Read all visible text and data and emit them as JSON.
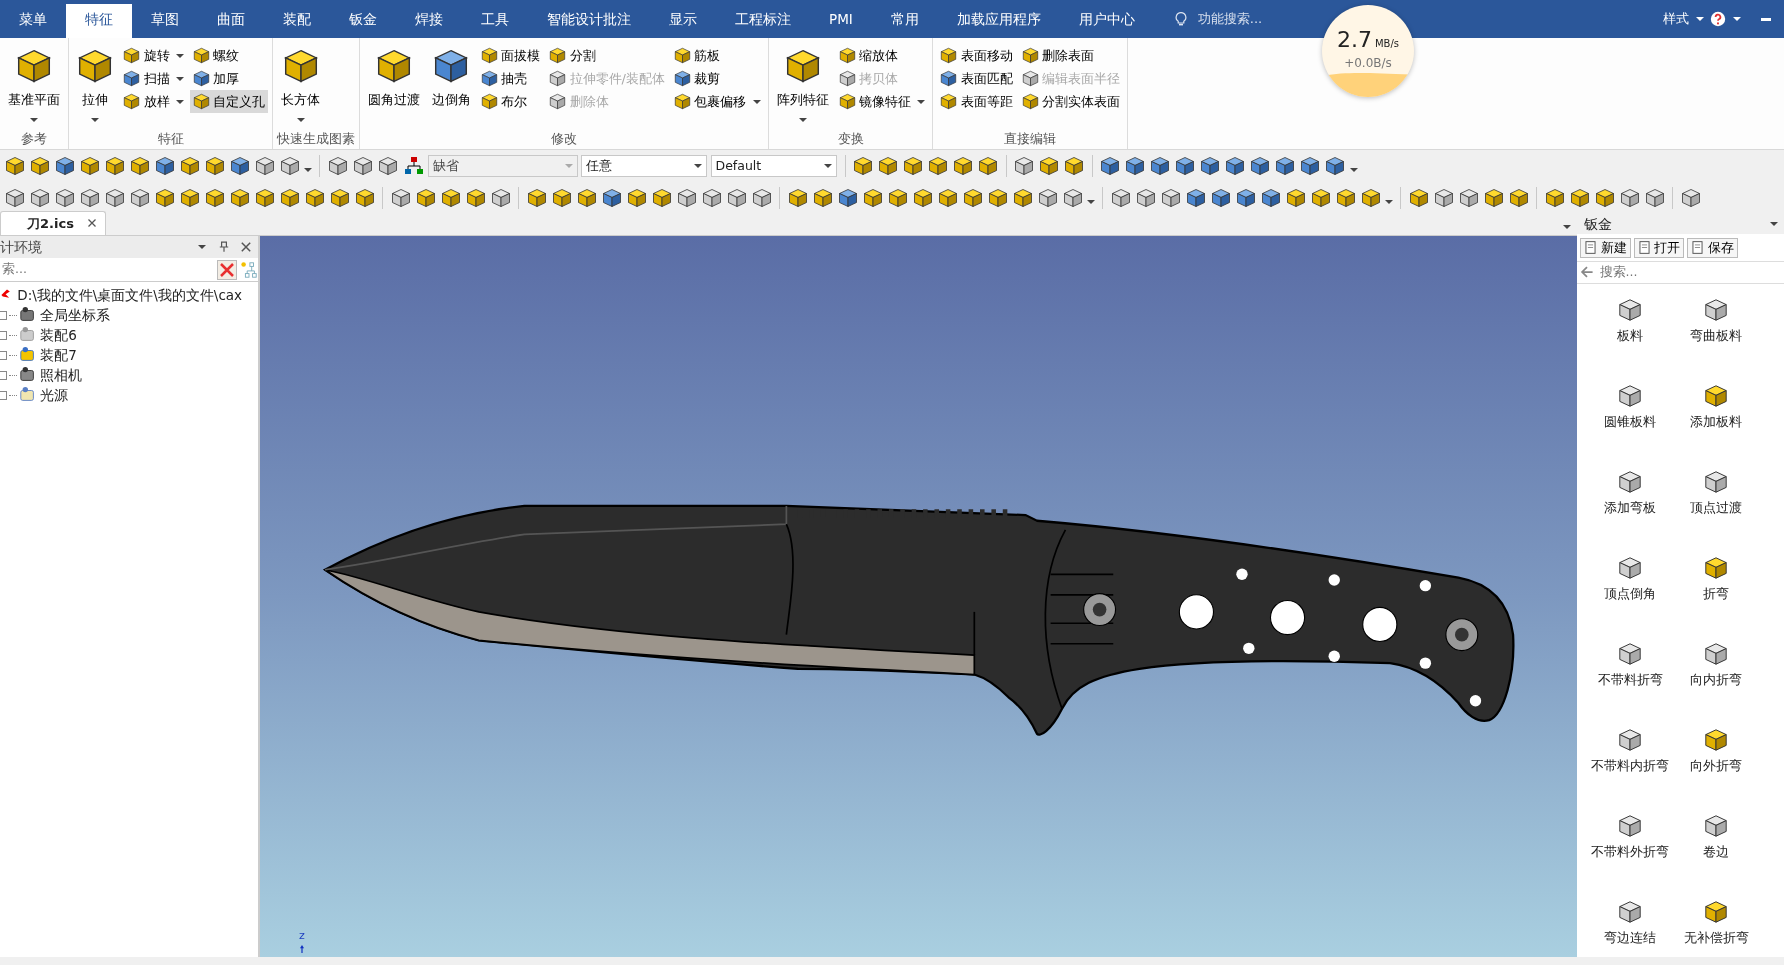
{
  "menu_tabs": [
    {
      "label": "菜单",
      "selected": false
    },
    {
      "label": "特征",
      "selected": true
    },
    {
      "label": "草图",
      "selected": false
    },
    {
      "label": "曲面",
      "selected": false
    },
    {
      "label": "装配",
      "selected": false
    },
    {
      "label": "钣金",
      "selected": false
    },
    {
      "label": "焊接",
      "selected": false
    },
    {
      "label": "工具",
      "selected": false
    },
    {
      "label": "智能设计批注",
      "selected": false
    },
    {
      "label": "显示",
      "selected": false
    },
    {
      "label": "工程标注",
      "selected": false
    },
    {
      "label": "PMI",
      "selected": false
    },
    {
      "label": "常用",
      "selected": false
    },
    {
      "label": "加载应用程序",
      "selected": false
    },
    {
      "label": "用户中心",
      "selected": false
    }
  ],
  "search": {
    "placeholder": "功能搜索..."
  },
  "style_menu": "样式",
  "speed_meter": {
    "value": "2.7",
    "unit": "MB/s",
    "delta": "+0.0B/s"
  },
  "ribbon_groups": [
    {
      "label": "参考",
      "columns": [
        {
          "kind": "large",
          "label": "基准平面",
          "dropdown": true,
          "disabled": false,
          "selected": false
        }
      ]
    },
    {
      "label": "特征",
      "columns": [
        {
          "kind": "large",
          "label": "拉伸",
          "dropdown": true,
          "disabled": false,
          "selected": false
        },
        {
          "kind": "stack",
          "items": [
            {
              "label": "旋转",
              "dropdown": true,
              "disabled": false,
              "selected": false
            },
            {
              "label": "扫描",
              "dropdown": true,
              "disabled": false,
              "selected": false
            },
            {
              "label": "放样",
              "dropdown": true,
              "disabled": false,
              "selected": false
            }
          ]
        },
        {
          "kind": "stack",
          "items": [
            {
              "label": "螺纹",
              "dropdown": false,
              "disabled": false,
              "selected": false
            },
            {
              "label": "加厚",
              "dropdown": false,
              "disabled": false,
              "selected": false
            },
            {
              "label": "自定义孔",
              "dropdown": false,
              "disabled": false,
              "selected": true
            }
          ]
        }
      ]
    },
    {
      "label": "快速生成图素",
      "columns": [
        {
          "kind": "large",
          "label": "长方体",
          "dropdown": true,
          "disabled": false,
          "selected": false
        }
      ]
    },
    {
      "label": "修改",
      "columns": [
        {
          "kind": "large",
          "label": "圆角过渡",
          "dropdown": false,
          "disabled": false,
          "selected": false
        },
        {
          "kind": "large",
          "label": "边倒角",
          "dropdown": false,
          "disabled": false,
          "selected": false
        },
        {
          "kind": "stack",
          "items": [
            {
              "label": "面拔模",
              "dropdown": false,
              "disabled": false,
              "selected": false
            },
            {
              "label": "抽壳",
              "dropdown": false,
              "disabled": false,
              "selected": false
            },
            {
              "label": "布尔",
              "dropdown": false,
              "disabled": false,
              "selected": false
            }
          ]
        },
        {
          "kind": "stack",
          "items": [
            {
              "label": "分割",
              "dropdown": false,
              "disabled": false,
              "selected": false
            },
            {
              "label": "拉伸零件/装配体",
              "dropdown": false,
              "disabled": true,
              "selected": false
            },
            {
              "label": "删除体",
              "dropdown": false,
              "disabled": true,
              "selected": false
            }
          ]
        },
        {
          "kind": "stack",
          "items": [
            {
              "label": "筋板",
              "dropdown": false,
              "disabled": false,
              "selected": false
            },
            {
              "label": "裁剪",
              "dropdown": false,
              "disabled": false,
              "selected": false
            },
            {
              "label": "包裹偏移",
              "dropdown": true,
              "disabled": false,
              "selected": false
            }
          ]
        }
      ]
    },
    {
      "label": "变换",
      "columns": [
        {
          "kind": "large",
          "label": "阵列特征",
          "dropdown": true,
          "disabled": false,
          "selected": false
        },
        {
          "kind": "stack",
          "items": [
            {
              "label": "缩放体",
              "dropdown": false,
              "disabled": false,
              "selected": false
            },
            {
              "label": "拷贝体",
              "dropdown": false,
              "disabled": true,
              "selected": false
            },
            {
              "label": "镜像特征",
              "dropdown": true,
              "disabled": false,
              "selected": false
            }
          ]
        }
      ]
    },
    {
      "label": "直接编辑",
      "columns": [
        {
          "kind": "stack",
          "items": [
            {
              "label": "表面移动",
              "dropdown": false,
              "disabled": false,
              "selected": false
            },
            {
              "label": "表面匹配",
              "dropdown": false,
              "disabled": false,
              "selected": false
            },
            {
              "label": "表面等距",
              "dropdown": false,
              "disabled": false,
              "selected": false
            }
          ]
        },
        {
          "kind": "stack",
          "items": [
            {
              "label": "删除表面",
              "dropdown": false,
              "disabled": false,
              "selected": false
            },
            {
              "label": "编辑表面半径",
              "dropdown": false,
              "disabled": true,
              "selected": false
            },
            {
              "label": "分割实体表面",
              "dropdown": false,
              "disabled": false,
              "selected": false
            }
          ]
        }
      ]
    }
  ],
  "toolbar_dropdowns": [
    {
      "value": "缺省",
      "disabled": true
    },
    {
      "value": "任意",
      "disabled": false
    },
    {
      "value": "Default",
      "disabled": false
    }
  ],
  "document_tabs": [
    {
      "label": "刀2.ics",
      "selected": true
    }
  ],
  "left_panel": {
    "title": "计环境",
    "search_placeholder": "索...",
    "tree": {
      "label": "D:\\我的文件\\桌面文件\\我的文件\\cax",
      "children": [
        {
          "label": "全局坐标系"
        },
        {
          "label": "装配6"
        },
        {
          "label": "装配7"
        },
        {
          "label": "照相机"
        },
        {
          "label": "光源"
        }
      ]
    }
  },
  "viewport": {
    "axis_label": "z"
  },
  "right_panel": {
    "title": "钣金",
    "buttons": [
      "新建",
      "打开",
      "保存"
    ],
    "search_placeholder": "搜索...",
    "items": [
      "板料",
      "弯曲板料",
      "圆锥板料",
      "添加板料",
      "添加弯板",
      "顶点过渡",
      "顶点倒角",
      "折弯",
      "不带料折弯",
      "向内折弯",
      "不带料内折弯",
      "向外折弯",
      "不带料外折弯",
      "卷边",
      "弯边连结",
      "无补偿折弯"
    ]
  }
}
